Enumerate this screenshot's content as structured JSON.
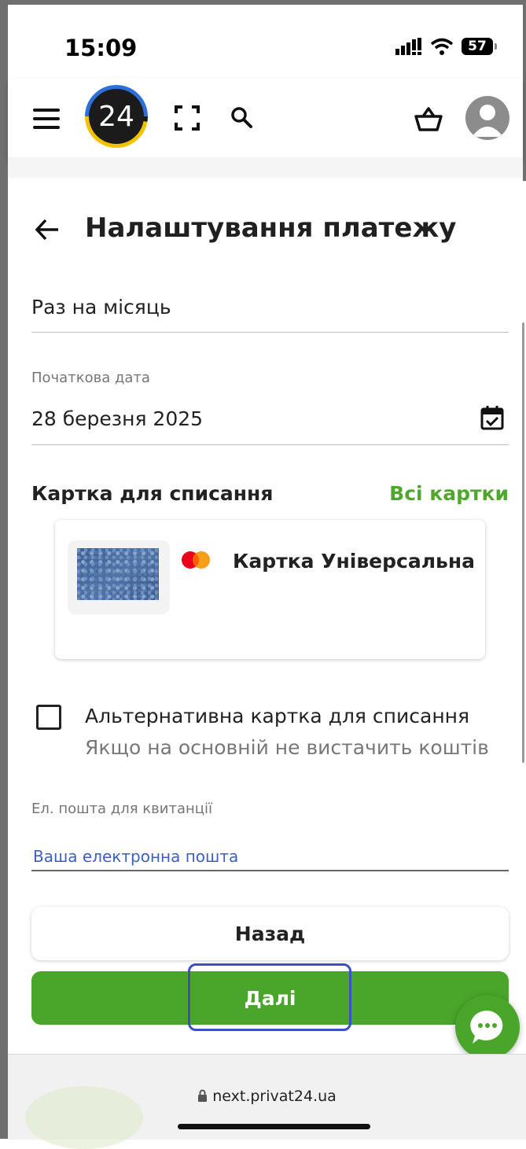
{
  "status_bar": {
    "time": "15:09",
    "battery": "57"
  },
  "header": {
    "logo_text": "24"
  },
  "page": {
    "title": "Налаштування платежу"
  },
  "frequency": {
    "value": "Раз на місяць"
  },
  "start_date": {
    "label": "Початкова дата",
    "value": "28 березня 2025"
  },
  "card_section": {
    "title": "Картка для списання",
    "all_cards_link": "Всі картки",
    "card_name": "Картка Універсальна"
  },
  "alternative_card": {
    "title": "Альтернативна картка для списання",
    "subtitle": "Якщо на основній не вистачить коштів",
    "checked": false
  },
  "email": {
    "label": "Ел. пошта для квитанції",
    "placeholder": "Ваша електронна пошта",
    "value": ""
  },
  "buttons": {
    "back": "Назад",
    "next": "Далі"
  },
  "browser": {
    "url": "next.privat24.ua"
  },
  "colors": {
    "accent_green": "#4aa62a",
    "link_green": "#4fa82c",
    "highlight_blue": "#3c4fc4"
  }
}
